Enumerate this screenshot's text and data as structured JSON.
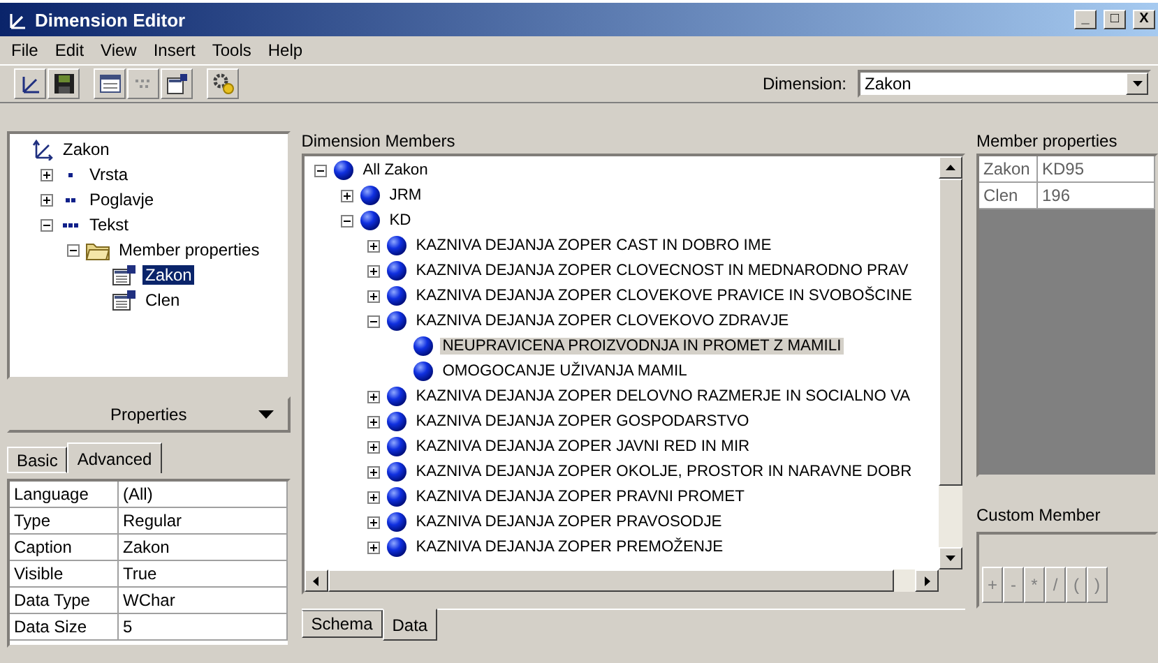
{
  "window": {
    "title": "Dimension Editor",
    "controls": [
      "_",
      "□",
      "X"
    ]
  },
  "menu": [
    "File",
    "Edit",
    "View",
    "Insert",
    "Tools",
    "Help"
  ],
  "dimension": {
    "label": "Dimension:",
    "value": "Zakon"
  },
  "structure_tree": [
    {
      "label": "Zakon",
      "kind": "dimension",
      "selected": false,
      "children": [
        {
          "label": "Vrsta",
          "kind": "level1",
          "expanded": false,
          "selected": false
        },
        {
          "label": "Poglavje",
          "kind": "level2",
          "expanded": false,
          "selected": false
        },
        {
          "label": "Tekst",
          "kind": "level3",
          "expanded": true,
          "selected": false,
          "children": [
            {
              "label": "Member properties",
              "kind": "folder",
              "expanded": true,
              "selected": false,
              "children": [
                {
                  "label": "Zakon",
                  "kind": "property",
                  "selected": true
                },
                {
                  "label": "Clen",
                  "kind": "property",
                  "selected": false
                }
              ]
            }
          ]
        }
      ]
    }
  ],
  "properties": {
    "title": "Properties",
    "tabs": [
      {
        "label": "Basic",
        "selected": false
      },
      {
        "label": "Advanced",
        "selected": true
      }
    ],
    "rows": [
      [
        "Language",
        "(All)"
      ],
      [
        "Type",
        "Regular"
      ],
      [
        "Caption",
        "Zakon"
      ],
      [
        "Visible",
        "True"
      ],
      [
        "Data Type",
        "WChar"
      ],
      [
        "Data Size",
        "5"
      ]
    ]
  },
  "members": {
    "label": "Dimension Members",
    "tree": [
      {
        "label": "All Zakon",
        "expanded": true,
        "selected": false,
        "children": [
          {
            "label": "JRM",
            "expanded": false,
            "selected": false
          },
          {
            "label": "KD",
            "expanded": true,
            "selected": false,
            "children": [
              {
                "label": "KAZNIVA DEJANJA ZOPER CAST IN DOBRO IME",
                "expanded": false,
                "selected": false
              },
              {
                "label": "KAZNIVA DEJANJA ZOPER CLOVECNOST IN MEDNARODNO PRAV",
                "expanded": false,
                "selected": false
              },
              {
                "label": "KAZNIVA DEJANJA ZOPER CLOVEKOVE PRAVICE IN SVOBOŠCINE",
                "expanded": false,
                "selected": false
              },
              {
                "label": "KAZNIVA DEJANJA ZOPER CLOVEKOVO ZDRAVJE",
                "expanded": true,
                "selected": false,
                "children": [
                  {
                    "label": "NEUPRAVICENA PROIZVODNJA IN PROMET Z MAMILI",
                    "selected": true
                  },
                  {
                    "label": "OMOGOCANJE UŽIVANJA MAMIL",
                    "selected": false
                  }
                ]
              },
              {
                "label": "KAZNIVA DEJANJA ZOPER DELOVNO RAZMERJE IN SOCIALNO VA",
                "expanded": false,
                "selected": false
              },
              {
                "label": "KAZNIVA DEJANJA ZOPER GOSPODARSTVO",
                "expanded": false,
                "selected": false
              },
              {
                "label": "KAZNIVA DEJANJA ZOPER JAVNI RED IN MIR",
                "expanded": false,
                "selected": false
              },
              {
                "label": "KAZNIVA DEJANJA ZOPER OKOLJE, PROSTOR IN NARAVNE DOBR",
                "expanded": false,
                "selected": false
              },
              {
                "label": "KAZNIVA DEJANJA ZOPER PRAVNI PROMET",
                "expanded": false,
                "selected": false
              },
              {
                "label": "KAZNIVA DEJANJA ZOPER PRAVOSODJE",
                "expanded": false,
                "selected": false
              },
              {
                "label": "KAZNIVA DEJANJA ZOPER PREMOŽENJE",
                "expanded": false,
                "selected": false
              }
            ]
          }
        ]
      }
    ]
  },
  "member_properties": {
    "label": "Member properties",
    "rows": [
      [
        "Zakon",
        "KD95"
      ],
      [
        "Clen",
        "196"
      ]
    ]
  },
  "custom_member": {
    "label": "Custom Member",
    "operators": [
      "+",
      "-",
      "*",
      "/",
      "(",
      ")"
    ]
  },
  "bottom_tabs": [
    {
      "label": "Schema",
      "selected": false
    },
    {
      "label": "Data",
      "selected": true
    }
  ]
}
